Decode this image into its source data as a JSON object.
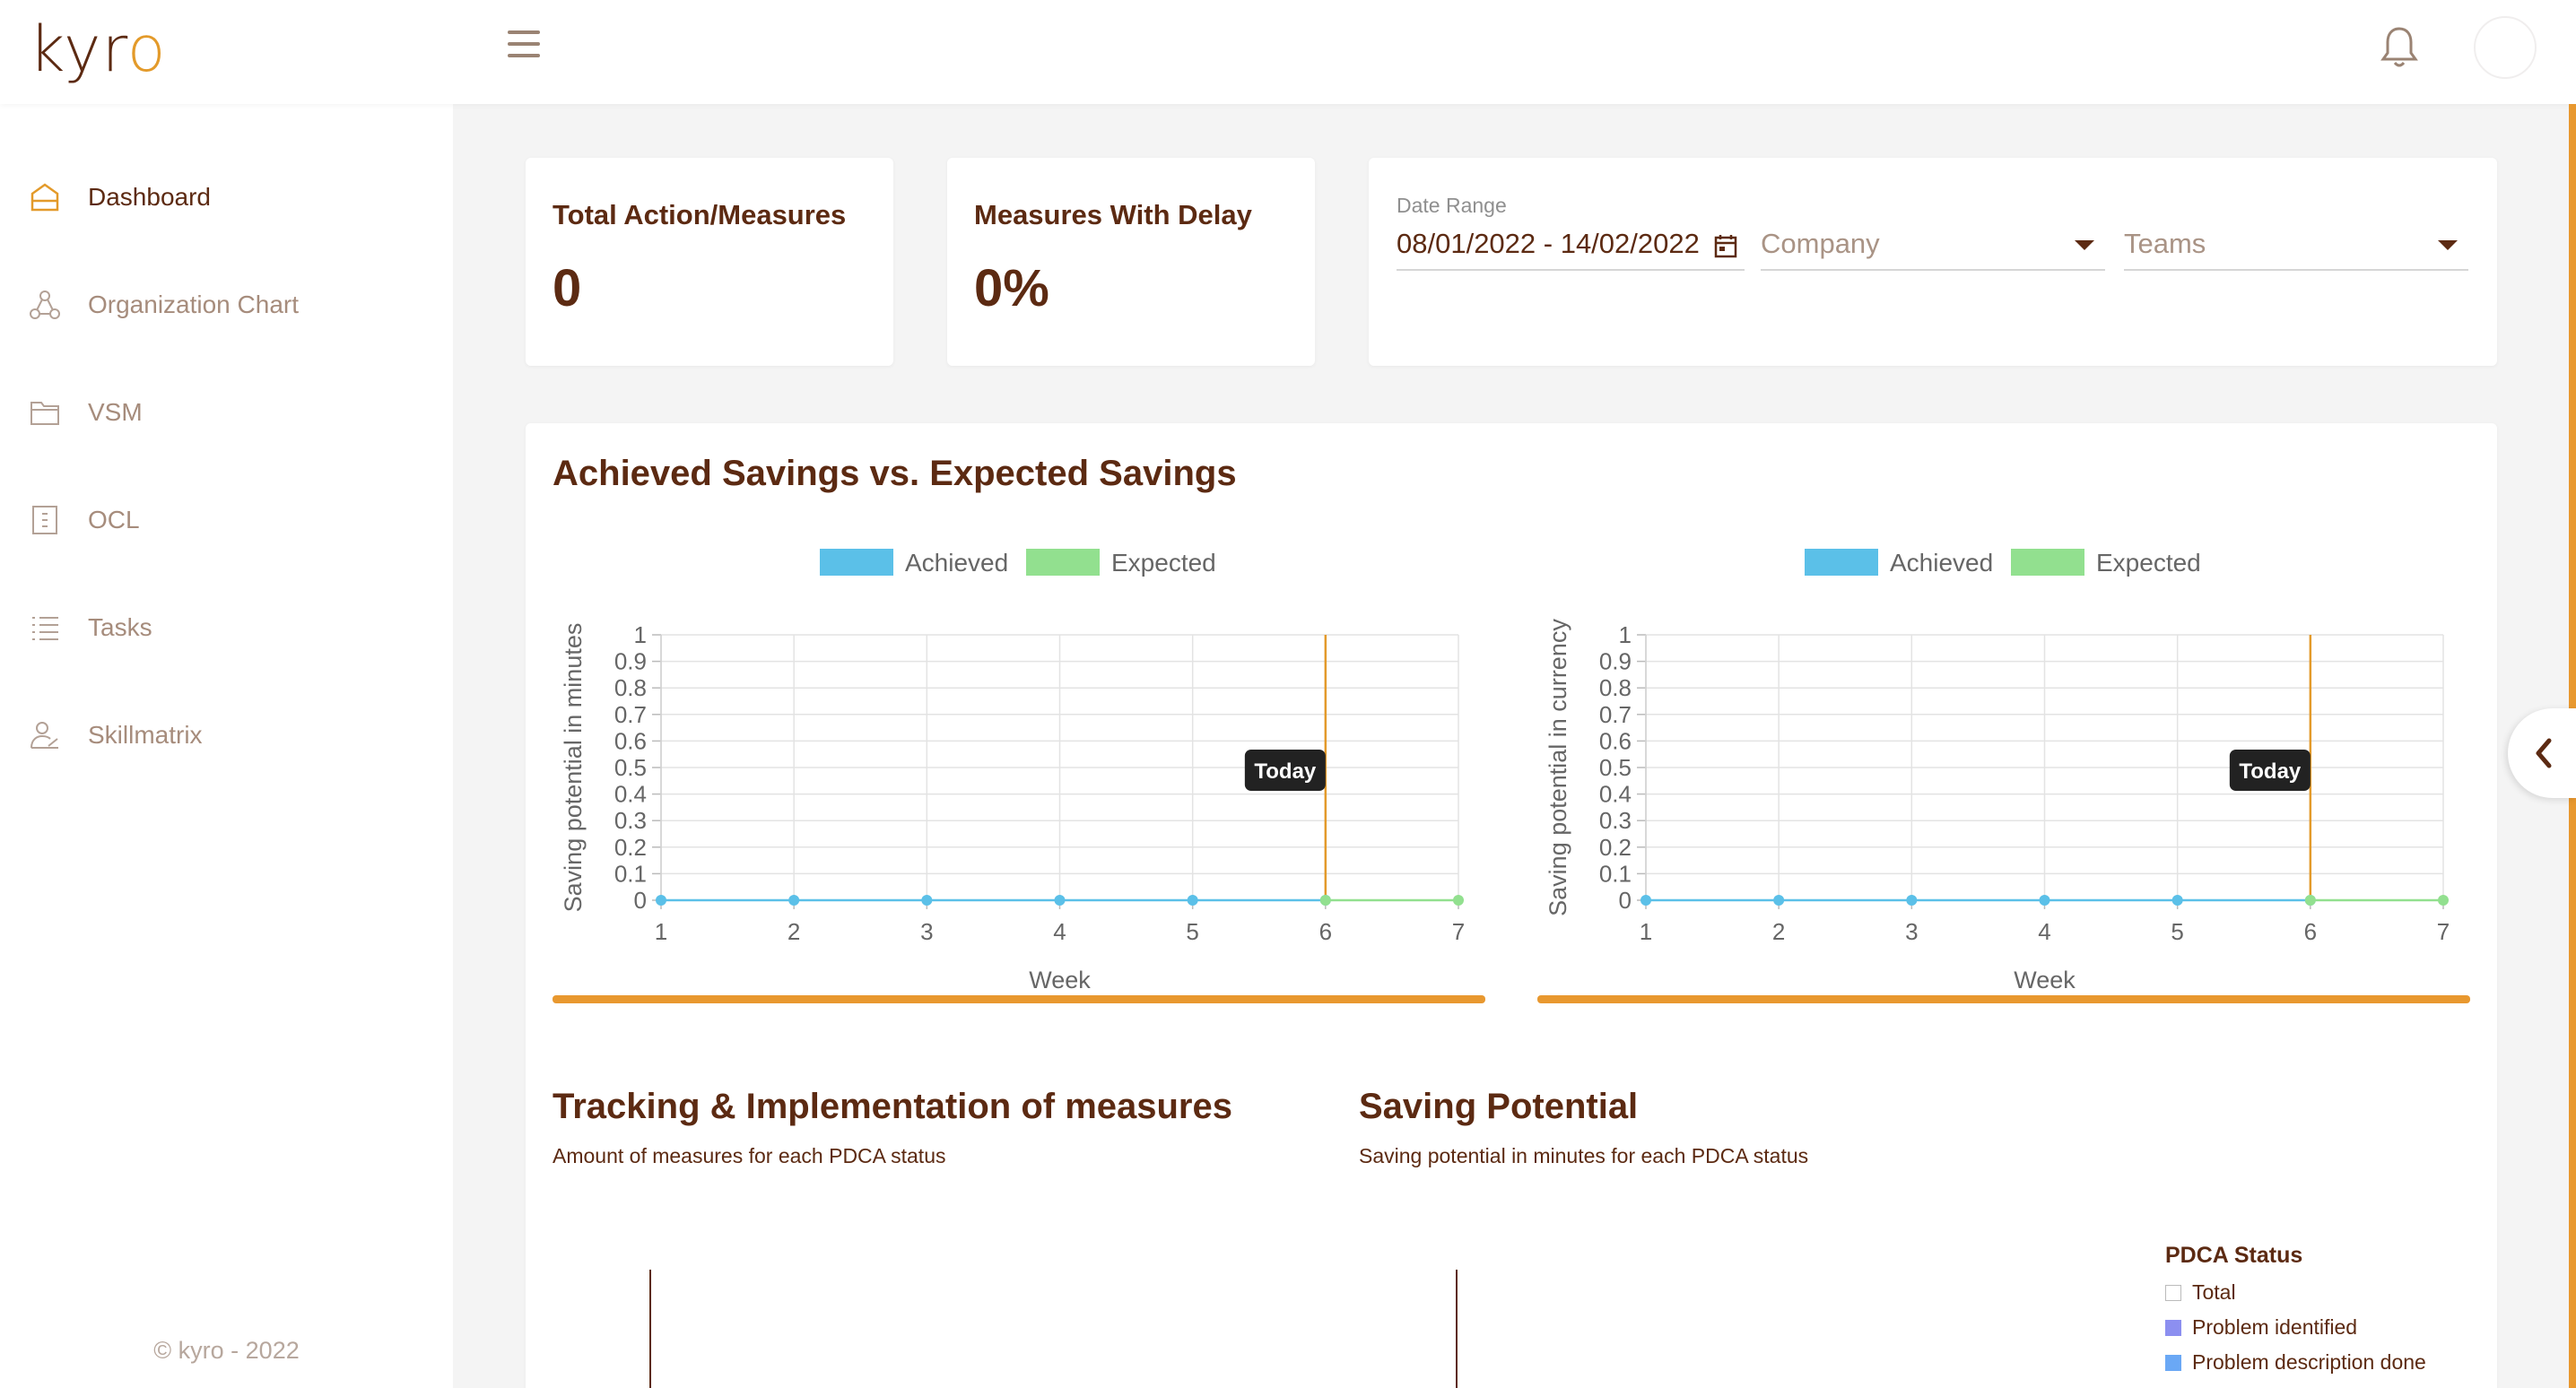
{
  "app": {
    "logo_text_a": "kyr",
    "logo_text_b": "o"
  },
  "sidebar": {
    "items": [
      {
        "label": "Dashboard",
        "icon": "home-icon",
        "active": true
      },
      {
        "label": "Organization Chart",
        "icon": "org-chart-icon",
        "active": false
      },
      {
        "label": "VSM",
        "icon": "folder-icon",
        "active": false
      },
      {
        "label": "OCL",
        "icon": "document-list-icon",
        "active": false
      },
      {
        "label": "Tasks",
        "icon": "list-icon",
        "active": false
      },
      {
        "label": "Skillmatrix",
        "icon": "person-skill-icon",
        "active": false
      }
    ],
    "copyright": "© kyro - 2022"
  },
  "kpis": [
    {
      "title": "Total Action/Measures",
      "value": "0"
    },
    {
      "title": "Measures With Delay",
      "value": "0%"
    }
  ],
  "filters": {
    "date_label": "Date Range",
    "date_value": "08/01/2022 - 14/02/2022",
    "company_placeholder": "Company",
    "teams_placeholder": "Teams"
  },
  "savings": {
    "title": "Achieved Savings vs. Expected Savings",
    "legend": [
      "Achieved",
      "Expected"
    ],
    "today_label": "Today"
  },
  "tracking": {
    "title": "Tracking & Implementation of measures",
    "subtitle": "Amount of measures for each PDCA status"
  },
  "potential": {
    "title": "Saving Potential",
    "subtitle": "Saving potential in minutes for each PDCA status"
  },
  "pdca_legend": {
    "title": "PDCA Status",
    "items": [
      {
        "label": "Total",
        "color": "#ffffff"
      },
      {
        "label": "Problem identified",
        "color": "#8c8ff0"
      },
      {
        "label": "Problem description done",
        "color": "#6aa8f5"
      }
    ]
  },
  "colors": {
    "achieved": "#5bc0e8",
    "expected": "#92e08f",
    "today_line": "#e39a2a",
    "accent": "#e8982f",
    "brand": "#5c2a12"
  },
  "chart_data": [
    {
      "type": "line",
      "x": [
        1,
        2,
        3,
        4,
        5,
        6,
        7
      ],
      "xlabel": "Week",
      "ylabel": "Saving potential in minutes",
      "ylim": [
        0,
        1
      ],
      "yticks": [
        0,
        0.1,
        0.2,
        0.3,
        0.4,
        0.5,
        0.6,
        0.7,
        0.8,
        0.9,
        1
      ],
      "today_week": 6,
      "series": [
        {
          "name": "Achieved",
          "values": [
            0,
            0,
            0,
            0,
            0,
            0,
            null
          ]
        },
        {
          "name": "Expected",
          "values": [
            null,
            null,
            null,
            null,
            null,
            0,
            0
          ]
        }
      ],
      "grid": true,
      "legend": "top"
    },
    {
      "type": "line",
      "x": [
        1,
        2,
        3,
        4,
        5,
        6,
        7
      ],
      "xlabel": "Week",
      "ylabel": "Saving potential in currency",
      "ylim": [
        0,
        1
      ],
      "yticks": [
        0,
        0.1,
        0.2,
        0.3,
        0.4,
        0.5,
        0.6,
        0.7,
        0.8,
        0.9,
        1
      ],
      "today_week": 6,
      "series": [
        {
          "name": "Achieved",
          "values": [
            0,
            0,
            0,
            0,
            0,
            0,
            null
          ]
        },
        {
          "name": "Expected",
          "values": [
            null,
            null,
            null,
            null,
            null,
            0,
            0
          ]
        }
      ],
      "grid": true,
      "legend": "top"
    }
  ]
}
